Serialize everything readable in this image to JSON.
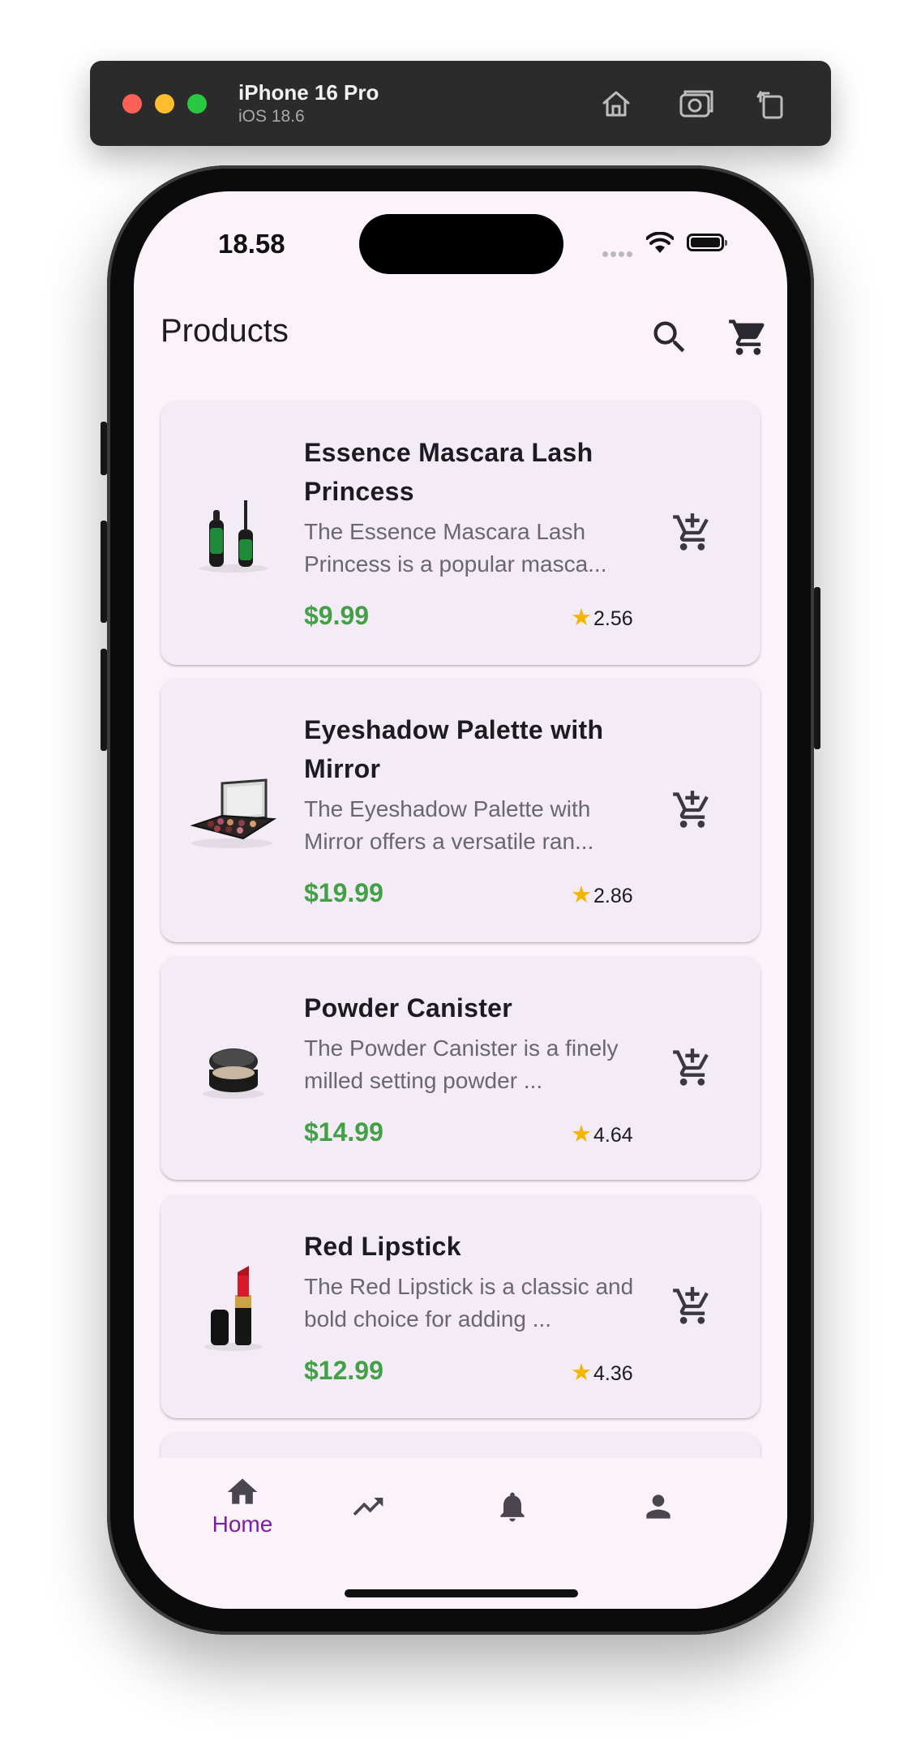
{
  "simulator": {
    "device_name": "iPhone 16 Pro",
    "os_version": "iOS 18.6",
    "buttons": [
      "home-icon",
      "screenshot-icon",
      "rotate-icon"
    ]
  },
  "status_bar": {
    "time": "18.58"
  },
  "app_bar": {
    "title": "Products",
    "actions": [
      "search-icon",
      "cart-icon"
    ]
  },
  "products": [
    {
      "name": "Essence Mascara Lash Princess",
      "description": "The Essence Mascara Lash Princess is a popular masca...",
      "price": "$9.99",
      "rating": "2.56",
      "image": "mascara"
    },
    {
      "name": "Eyeshadow Palette with Mirror",
      "description": "The Eyeshadow Palette with Mirror offers a versatile ran...",
      "price": "$19.99",
      "rating": "2.86",
      "image": "eyeshadow-palette"
    },
    {
      "name": "Powder Canister",
      "description": "The Powder Canister is a finely milled setting powder ...",
      "price": "$14.99",
      "rating": "4.64",
      "image": "powder-canister"
    },
    {
      "name": "Red Lipstick",
      "description": "The Red Lipstick is a classic and bold choice for adding ...",
      "price": "$12.99",
      "rating": "4.36",
      "image": "red-lipstick"
    }
  ],
  "bottom_nav": {
    "items": [
      {
        "label": "Home",
        "icon": "home-icon",
        "selected": true
      },
      {
        "label": "",
        "icon": "trending-icon",
        "selected": false
      },
      {
        "label": "",
        "icon": "notifications-icon",
        "selected": false
      },
      {
        "label": "",
        "icon": "profile-icon",
        "selected": false
      }
    ]
  },
  "colors": {
    "background": "#fcf2fa",
    "card": "#f3ebf5",
    "price": "#43a047",
    "accent": "#7b1fa2",
    "star": "#f5b400"
  }
}
